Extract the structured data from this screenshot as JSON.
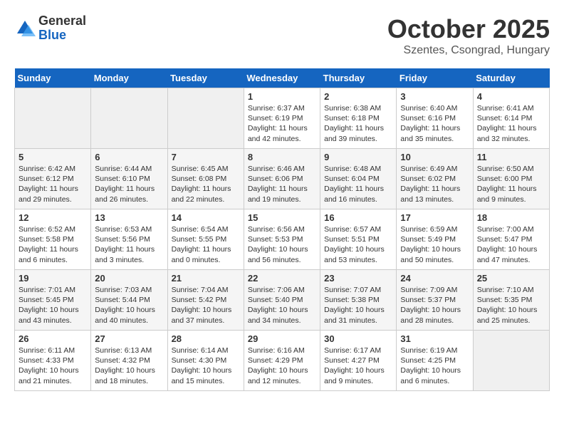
{
  "logo": {
    "general": "General",
    "blue": "Blue"
  },
  "title": "October 2025",
  "subtitle": "Szentes, Csongrad, Hungary",
  "days_header": [
    "Sunday",
    "Monday",
    "Tuesday",
    "Wednesday",
    "Thursday",
    "Friday",
    "Saturday"
  ],
  "weeks": [
    [
      {
        "day": "",
        "info": ""
      },
      {
        "day": "",
        "info": ""
      },
      {
        "day": "",
        "info": ""
      },
      {
        "day": "1",
        "info": "Sunrise: 6:37 AM\nSunset: 6:19 PM\nDaylight: 11 hours\nand 42 minutes."
      },
      {
        "day": "2",
        "info": "Sunrise: 6:38 AM\nSunset: 6:18 PM\nDaylight: 11 hours\nand 39 minutes."
      },
      {
        "day": "3",
        "info": "Sunrise: 6:40 AM\nSunset: 6:16 PM\nDaylight: 11 hours\nand 35 minutes."
      },
      {
        "day": "4",
        "info": "Sunrise: 6:41 AM\nSunset: 6:14 PM\nDaylight: 11 hours\nand 32 minutes."
      }
    ],
    [
      {
        "day": "5",
        "info": "Sunrise: 6:42 AM\nSunset: 6:12 PM\nDaylight: 11 hours\nand 29 minutes."
      },
      {
        "day": "6",
        "info": "Sunrise: 6:44 AM\nSunset: 6:10 PM\nDaylight: 11 hours\nand 26 minutes."
      },
      {
        "day": "7",
        "info": "Sunrise: 6:45 AM\nSunset: 6:08 PM\nDaylight: 11 hours\nand 22 minutes."
      },
      {
        "day": "8",
        "info": "Sunrise: 6:46 AM\nSunset: 6:06 PM\nDaylight: 11 hours\nand 19 minutes."
      },
      {
        "day": "9",
        "info": "Sunrise: 6:48 AM\nSunset: 6:04 PM\nDaylight: 11 hours\nand 16 minutes."
      },
      {
        "day": "10",
        "info": "Sunrise: 6:49 AM\nSunset: 6:02 PM\nDaylight: 11 hours\nand 13 minutes."
      },
      {
        "day": "11",
        "info": "Sunrise: 6:50 AM\nSunset: 6:00 PM\nDaylight: 11 hours\nand 9 minutes."
      }
    ],
    [
      {
        "day": "12",
        "info": "Sunrise: 6:52 AM\nSunset: 5:58 PM\nDaylight: 11 hours\nand 6 minutes."
      },
      {
        "day": "13",
        "info": "Sunrise: 6:53 AM\nSunset: 5:56 PM\nDaylight: 11 hours\nand 3 minutes."
      },
      {
        "day": "14",
        "info": "Sunrise: 6:54 AM\nSunset: 5:55 PM\nDaylight: 11 hours\nand 0 minutes."
      },
      {
        "day": "15",
        "info": "Sunrise: 6:56 AM\nSunset: 5:53 PM\nDaylight: 10 hours\nand 56 minutes."
      },
      {
        "day": "16",
        "info": "Sunrise: 6:57 AM\nSunset: 5:51 PM\nDaylight: 10 hours\nand 53 minutes."
      },
      {
        "day": "17",
        "info": "Sunrise: 6:59 AM\nSunset: 5:49 PM\nDaylight: 10 hours\nand 50 minutes."
      },
      {
        "day": "18",
        "info": "Sunrise: 7:00 AM\nSunset: 5:47 PM\nDaylight: 10 hours\nand 47 minutes."
      }
    ],
    [
      {
        "day": "19",
        "info": "Sunrise: 7:01 AM\nSunset: 5:45 PM\nDaylight: 10 hours\nand 43 minutes."
      },
      {
        "day": "20",
        "info": "Sunrise: 7:03 AM\nSunset: 5:44 PM\nDaylight: 10 hours\nand 40 minutes."
      },
      {
        "day": "21",
        "info": "Sunrise: 7:04 AM\nSunset: 5:42 PM\nDaylight: 10 hours\nand 37 minutes."
      },
      {
        "day": "22",
        "info": "Sunrise: 7:06 AM\nSunset: 5:40 PM\nDaylight: 10 hours\nand 34 minutes."
      },
      {
        "day": "23",
        "info": "Sunrise: 7:07 AM\nSunset: 5:38 PM\nDaylight: 10 hours\nand 31 minutes."
      },
      {
        "day": "24",
        "info": "Sunrise: 7:09 AM\nSunset: 5:37 PM\nDaylight: 10 hours\nand 28 minutes."
      },
      {
        "day": "25",
        "info": "Sunrise: 7:10 AM\nSunset: 5:35 PM\nDaylight: 10 hours\nand 25 minutes."
      }
    ],
    [
      {
        "day": "26",
        "info": "Sunrise: 6:11 AM\nSunset: 4:33 PM\nDaylight: 10 hours\nand 21 minutes."
      },
      {
        "day": "27",
        "info": "Sunrise: 6:13 AM\nSunset: 4:32 PM\nDaylight: 10 hours\nand 18 minutes."
      },
      {
        "day": "28",
        "info": "Sunrise: 6:14 AM\nSunset: 4:30 PM\nDaylight: 10 hours\nand 15 minutes."
      },
      {
        "day": "29",
        "info": "Sunrise: 6:16 AM\nSunset: 4:29 PM\nDaylight: 10 hours\nand 12 minutes."
      },
      {
        "day": "30",
        "info": "Sunrise: 6:17 AM\nSunset: 4:27 PM\nDaylight: 10 hours\nand 9 minutes."
      },
      {
        "day": "31",
        "info": "Sunrise: 6:19 AM\nSunset: 4:25 PM\nDaylight: 10 hours\nand 6 minutes."
      },
      {
        "day": "",
        "info": ""
      }
    ]
  ]
}
